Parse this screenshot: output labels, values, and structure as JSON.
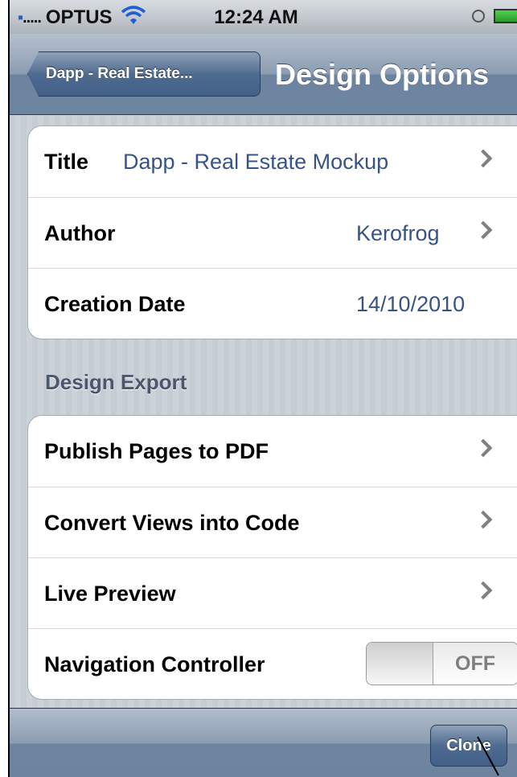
{
  "status_bar": {
    "carrier": "OPTUS",
    "signal_dots": ".....",
    "time": "12:24 AM",
    "icons": [
      "wifi-icon",
      "clock-icon",
      "battery-icon"
    ]
  },
  "nav": {
    "back_label": "Dapp - Real Estate...",
    "title": "Design Options"
  },
  "info_group": {
    "rows": [
      {
        "label": "Title",
        "value": "Dapp - Real Estate Mockup",
        "disclosure": true
      },
      {
        "label": "Author",
        "value": "Kerofrog",
        "disclosure": true
      },
      {
        "label": "Creation Date",
        "value": "14/10/2010",
        "disclosure": false
      }
    ]
  },
  "export_section": {
    "header": "Design Export",
    "rows": [
      {
        "label": "Publish Pages to PDF",
        "disclosure": true
      },
      {
        "label": "Convert Views into Code",
        "disclosure": true
      },
      {
        "label": "Live Preview",
        "disclosure": true
      },
      {
        "label": "Navigation Controller",
        "toggle": "OFF"
      }
    ]
  },
  "toolbar": {
    "clone_label": "Clone"
  },
  "colors": {
    "value_blue": "#385487",
    "nav_bar": "#6d84a0",
    "background_stripes": "#c5ccd4"
  }
}
